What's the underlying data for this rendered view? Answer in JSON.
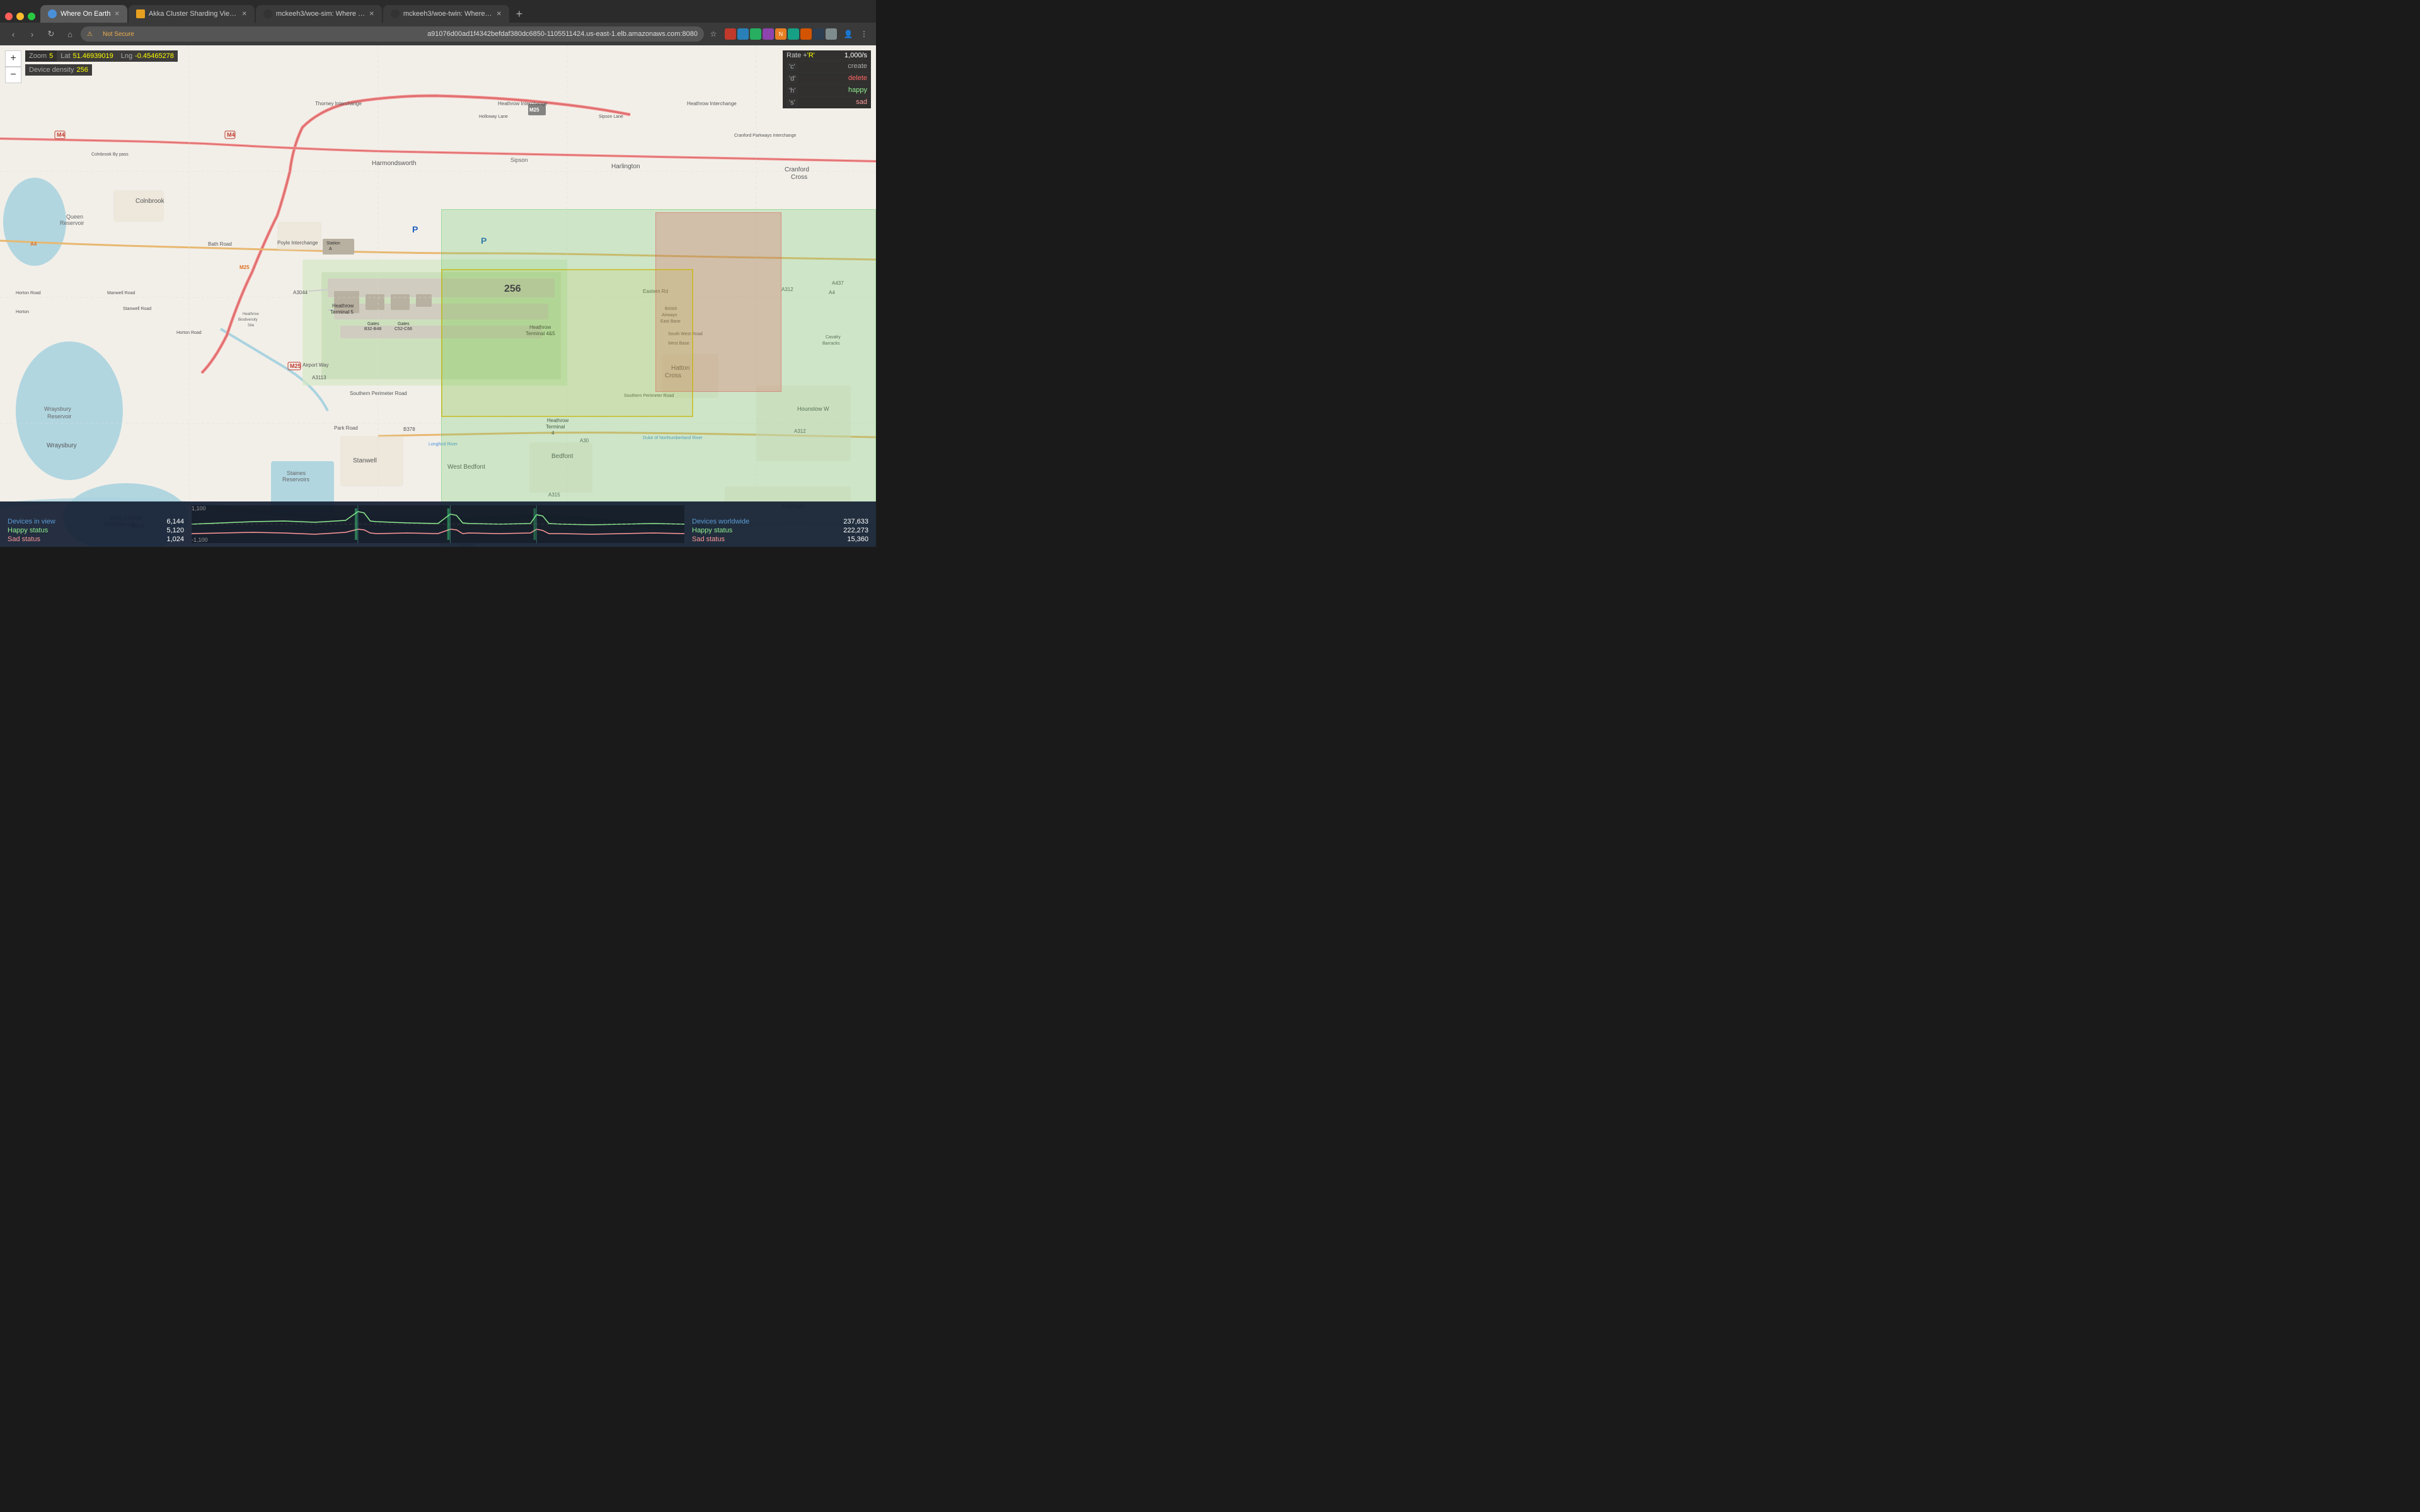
{
  "browser": {
    "tabs": [
      {
        "id": "tab1",
        "title": "Where On Earth",
        "favicon": "globe",
        "active": true
      },
      {
        "id": "tab2",
        "title": "Akka Cluster Sharding Viewer",
        "favicon": "akka",
        "active": false
      },
      {
        "id": "tab3",
        "title": "mckeeh3/woe-sim: Where On...",
        "favicon": "github",
        "active": false
      },
      {
        "id": "tab4",
        "title": "mckeeh3/woe-twin: Where On...",
        "favicon": "github",
        "active": false
      }
    ],
    "url": "a91076d00ad1f4342befdaf380dc6850-1105511424.us-east-1.elb.amazonaws.com:8080",
    "url_prefix": "Not Secure"
  },
  "map": {
    "zoom": 5,
    "lat": "51.46939019",
    "lng": "-0.45465278",
    "device_density_label": "Device density",
    "device_density_value": "256",
    "density_number": "256"
  },
  "shortcuts": {
    "rate_label": "Rate +",
    "rate_key": "'R'",
    "rate_value": "1,000/s",
    "create_key": "'c'",
    "create_label": "create",
    "delete_key": "'d'",
    "delete_label": "delete",
    "happy_key": "'h'",
    "happy_label": "happy",
    "sad_key": "'s'",
    "sad_label": "sad"
  },
  "stats_left": {
    "devices_label": "Devices in view",
    "devices_value": "6,144",
    "happy_label": "Happy status",
    "happy_value": "5,120",
    "sad_label": "Sad status",
    "sad_value": "1,024"
  },
  "stats_right": {
    "devices_label": "Devices worldwide",
    "devices_value": "237,633",
    "happy_label": "Happy status",
    "happy_value": "222,273",
    "sad_label": "Sad status",
    "sad_value": "15,360"
  },
  "chart": {
    "y_top": "1,100",
    "y_bottom": "-1,100"
  },
  "zoom_buttons": {
    "plus": "+",
    "minus": "−"
  }
}
